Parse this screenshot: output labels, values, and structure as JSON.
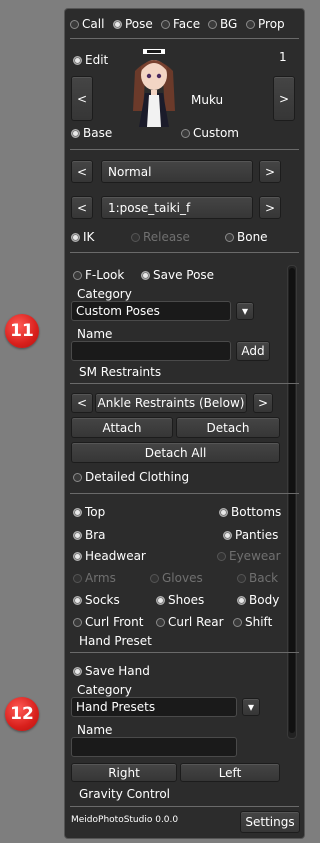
{
  "markers": {
    "a": "11",
    "b": "12"
  },
  "top_tabs": [
    {
      "label": "Call",
      "on": false
    },
    {
      "label": "Pose",
      "on": true
    },
    {
      "label": "Face",
      "on": false
    },
    {
      "label": "BG",
      "on": false
    },
    {
      "label": "Prop",
      "on": false
    }
  ],
  "maid": {
    "edit_label": "Edit",
    "index": "1",
    "name": "Muku",
    "prev": "<",
    "next": ">"
  },
  "base_custom": {
    "base": "Base",
    "custom": "Custom"
  },
  "pose": {
    "group": "Normal",
    "pose": "1:pose_taiki_f",
    "prev": "<",
    "next": ">"
  },
  "ik": {
    "ik": "IK",
    "release": "Release",
    "bone": "Bone"
  },
  "save_pose": {
    "f_look": "F-Look",
    "save_pose": "Save Pose",
    "category_label": "Category",
    "category_value": "Custom Poses",
    "dropdown": "▾",
    "name_label": "Name",
    "name_value": "",
    "add": "Add"
  },
  "sm": {
    "heading": "SM Restraints",
    "selected": "Ankle Restraints (Below)",
    "prev": "<",
    "next": ">",
    "attach": "Attach",
    "detach": "Detach",
    "detach_all": "Detach All",
    "detailed_clothing": "Detailed Clothing"
  },
  "clothing": [
    {
      "label": "Top",
      "on": true,
      "dis": false
    },
    {
      "label": "Bottoms",
      "on": true,
      "dis": false
    },
    {
      "label": "Bra",
      "on": true,
      "dis": false
    },
    {
      "label": "Panties",
      "on": true,
      "dis": false
    },
    {
      "label": "Headwear",
      "on": true,
      "dis": false
    },
    {
      "label": "Eyewear",
      "on": false,
      "dis": true
    },
    {
      "label": "Arms",
      "on": false,
      "dis": true
    },
    {
      "label": "Gloves",
      "on": false,
      "dis": true
    },
    {
      "label": "Back",
      "on": false,
      "dis": true
    },
    {
      "label": "Socks",
      "on": true,
      "dis": false
    },
    {
      "label": "Shoes",
      "on": true,
      "dis": false
    },
    {
      "label": "Body",
      "on": true,
      "dis": false
    },
    {
      "label": "Curl Front",
      "on": false,
      "dis": false
    },
    {
      "label": "Curl Rear",
      "on": false,
      "dis": false
    },
    {
      "label": "Shift",
      "on": false,
      "dis": false
    }
  ],
  "hand": {
    "heading": "Hand Preset",
    "save_hand": "Save Hand",
    "category_label": "Category",
    "category_value": "Hand Presets",
    "dropdown": "▾",
    "name_label": "Name",
    "name_value": "",
    "right": "Right",
    "left": "Left"
  },
  "gravity": {
    "heading": "Gravity Control"
  },
  "footer": {
    "version": "MeidoPhotoStudio 0.0.0",
    "settings": "Settings"
  }
}
